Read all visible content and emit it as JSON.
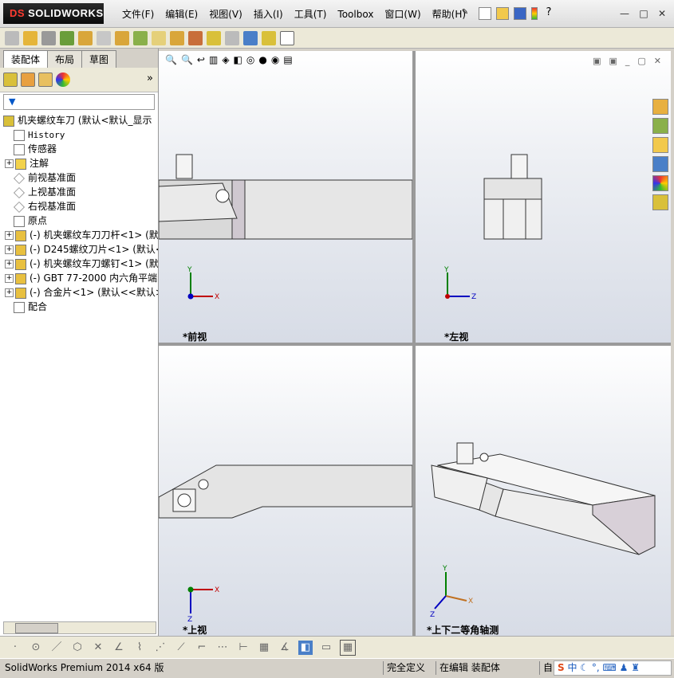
{
  "app": {
    "brand_ds": "DS",
    "brand_name": "SOLIDWORKS"
  },
  "menu": [
    "文件(F)",
    "编辑(E)",
    "视图(V)",
    "插入(I)",
    "工具(T)",
    "Toolbox",
    "窗口(W)",
    "帮助(H)"
  ],
  "window_buttons": [
    "—",
    "□",
    "✕"
  ],
  "panel_tabs": [
    "装配体",
    "布局",
    "草图"
  ],
  "tree": {
    "root": "机夹螺纹车刀  (默认<默认_显示",
    "items": [
      {
        "label": "History",
        "mono": true,
        "expand": ""
      },
      {
        "label": "传感器",
        "mono": false,
        "expand": ""
      },
      {
        "label": "注解",
        "mono": false,
        "expand": "+"
      },
      {
        "label": "前视基准面",
        "mono": false,
        "expand": ""
      },
      {
        "label": "上视基准面",
        "mono": false,
        "expand": ""
      },
      {
        "label": "右视基准面",
        "mono": false,
        "expand": ""
      },
      {
        "label": "原点",
        "mono": false,
        "expand": ""
      },
      {
        "label": "(-) 机夹螺纹车刀刀杆<1> (默",
        "mono": false,
        "expand": "+"
      },
      {
        "label": "(-) D245螺纹刀片<1> (默认<",
        "mono": false,
        "expand": "+"
      },
      {
        "label": "(-) 机夹螺纹车刀螺钉<1> (默",
        "mono": false,
        "expand": "+"
      },
      {
        "label": "(-) GBT 77-2000 内六角平端",
        "mono": false,
        "expand": "+"
      },
      {
        "label": "(-) 合金片<1> (默认<<默认>",
        "mono": false,
        "expand": "+"
      },
      {
        "label": "配合",
        "mono": false,
        "expand": ""
      }
    ]
  },
  "views": {
    "front": {
      "label": "*前视",
      "axes": [
        "Y",
        "X"
      ]
    },
    "left": {
      "label": "*左视",
      "axes": [
        "Y",
        "Z"
      ]
    },
    "top": {
      "label": "*上视",
      "axes": [
        "X",
        "Z"
      ]
    },
    "iso": {
      "label": "*上下二等角轴测",
      "axes": [
        "Y",
        "X",
        "Z"
      ]
    }
  },
  "status": {
    "product": "SolidWorks Premium 2014 x64 版",
    "defined": "完全定义",
    "editing": "在编辑 装配体",
    "custom": "自"
  },
  "colors": {
    "accent": "#1f5fbf",
    "axis_x": "#c00000",
    "axis_y": "#008000",
    "axis_z": "#0000c0"
  }
}
